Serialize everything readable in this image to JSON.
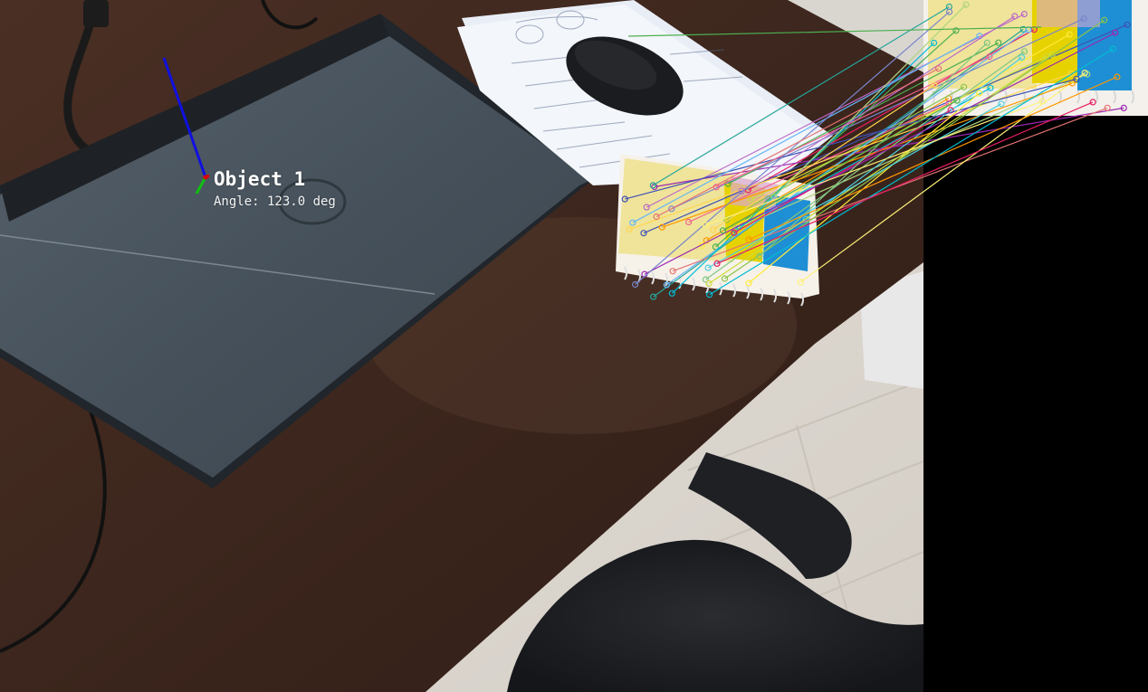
{
  "detection": {
    "object_label": "Object 1",
    "angle_text": "Angle: 123.0 deg",
    "axis_colors": {
      "x": "#e00000",
      "y": "#10c010",
      "z": "#1010e0"
    }
  },
  "reference_panel": {
    "background": "#000000"
  },
  "match_colors": [
    "#4caf50",
    "#ff9800",
    "#00bcd4",
    "#e91e63",
    "#cddc39",
    "#9c27b0",
    "#3f51b5",
    "#ffeb3b",
    "#26a69a",
    "#8bc34a",
    "#f06292",
    "#64b5f6",
    "#aed581",
    "#ba68c8",
    "#ffd54f",
    "#4dd0e1",
    "#81c784",
    "#7986cb",
    "#e57373",
    "#fff176"
  ],
  "scene": {
    "icons": [
      "laptop-icon",
      "mouse-icon",
      "notebook-icon",
      "chair-icon",
      "cable-icon",
      "paper-icon"
    ]
  }
}
